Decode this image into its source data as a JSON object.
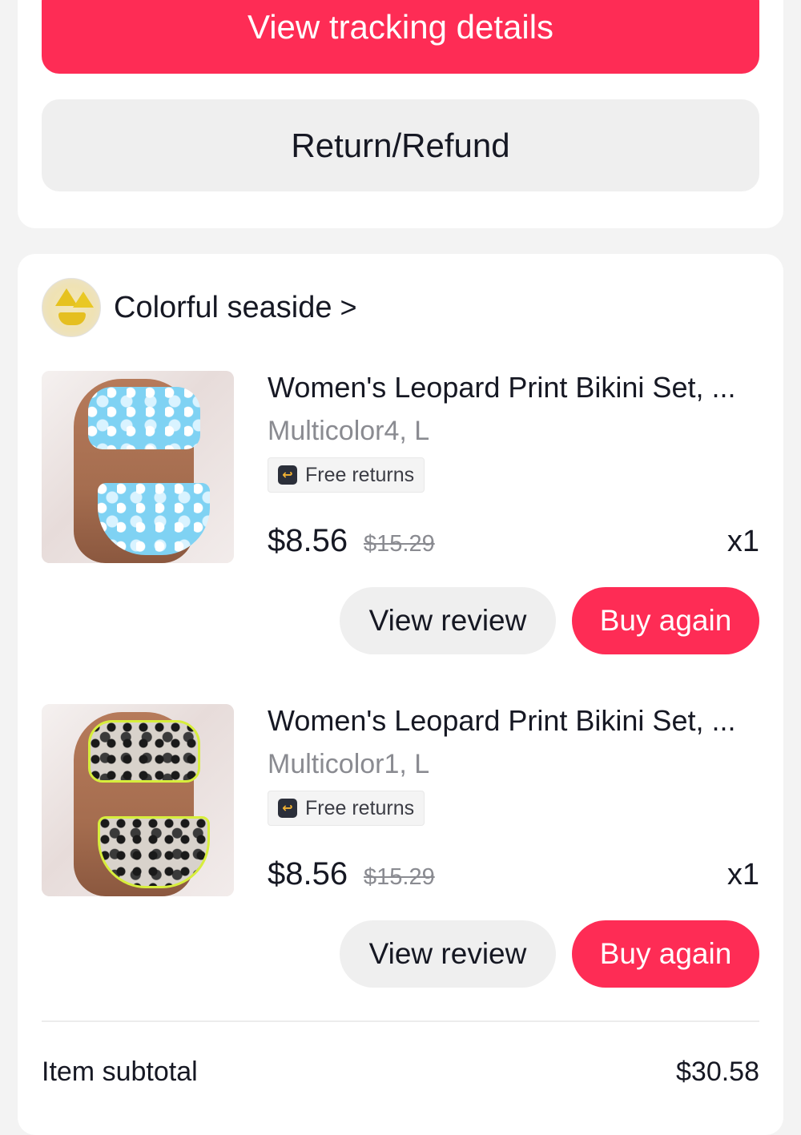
{
  "actions": {
    "track_label": "View tracking details",
    "refund_label": "Return/Refund"
  },
  "shop": {
    "name": "Colorful seaside",
    "chevron": ">"
  },
  "items": [
    {
      "title": "Women's Leopard Print Bikini Set, ...",
      "variant": "Multicolor4, L",
      "badge": "Free returns",
      "price": "$8.56",
      "original_price": "$15.29",
      "quantity": "x1",
      "review_label": "View review",
      "buy_label": "Buy again"
    },
    {
      "title": "Women's Leopard Print Bikini Set, ...",
      "variant": "Multicolor1, L",
      "badge": "Free returns",
      "price": "$8.56",
      "original_price": "$15.29",
      "quantity": "x1",
      "review_label": "View review",
      "buy_label": "Buy again"
    }
  ],
  "summary": {
    "subtotal_label": "Item subtotal",
    "subtotal_value": "$30.58"
  },
  "colors": {
    "accent": "#fe2c55",
    "secondary_button": "#efefef"
  }
}
